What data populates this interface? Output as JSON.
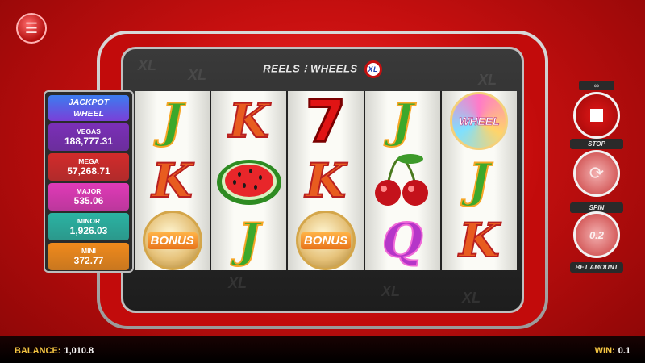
{
  "header": {
    "title": "REELS ⁝ WHEELS",
    "badge": "XL"
  },
  "watermark": "XL",
  "jackpot": {
    "title_line1": "JACKPOT",
    "title_line2": "WHEEL",
    "items": [
      {
        "name": "VEGAS",
        "amount": "188,777.31",
        "color": "#7b2fb8"
      },
      {
        "name": "MEGA",
        "amount": "57,268.71",
        "color": "#d22b2b"
      },
      {
        "name": "MAJOR",
        "amount": "535.06",
        "color": "#e03ab8"
      },
      {
        "name": "MINOR",
        "amount": "1,926.03",
        "color": "#2bb3a3"
      },
      {
        "name": "MINI",
        "amount": "372.77",
        "color": "#f08a1c"
      }
    ]
  },
  "reels": [
    [
      "J",
      "K",
      "BONUS"
    ],
    [
      "K",
      "watermelon",
      "J"
    ],
    [
      "7",
      "K",
      "BONUS"
    ],
    [
      "J",
      "cherries",
      "Q"
    ],
    [
      "WHEEL",
      "J",
      "K"
    ]
  ],
  "controls": {
    "infinity": "∞",
    "stop_label": "STOP",
    "spin_label": "SPIN",
    "bet_label": "BET AMOUNT",
    "bet_value": "0.2"
  },
  "footer": {
    "balance_label": "BALANCE:",
    "balance_value": "1,010.8",
    "win_label": "WIN:",
    "win_value": "0.1"
  }
}
